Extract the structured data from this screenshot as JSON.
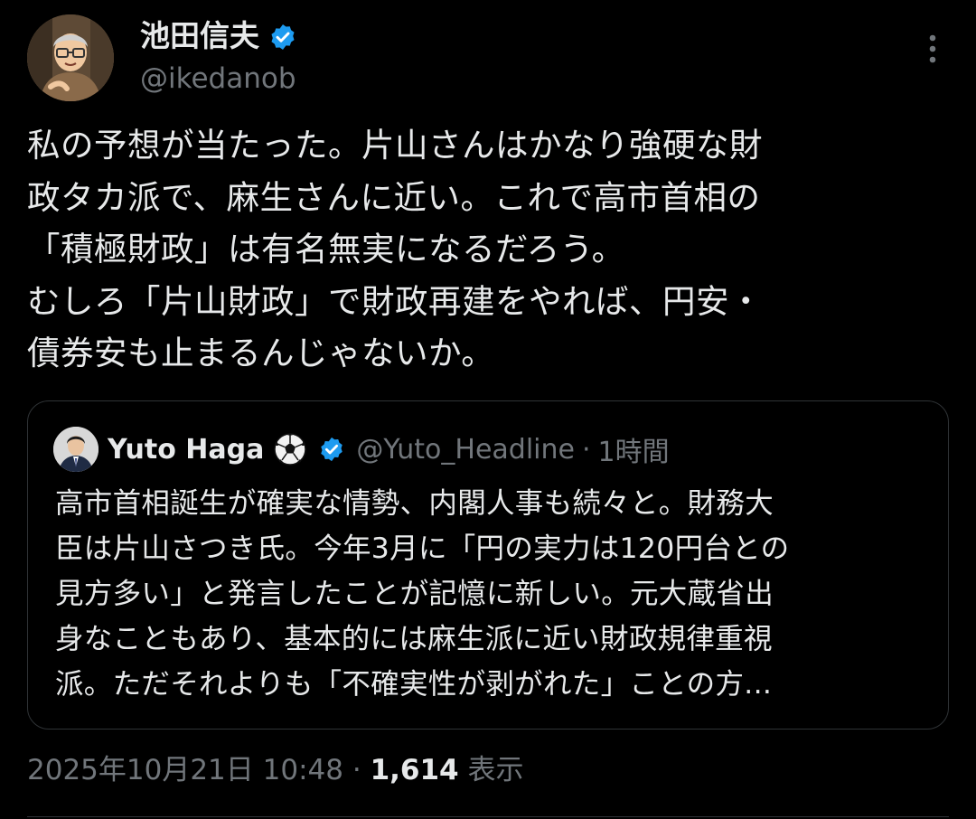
{
  "author": {
    "name": "池田信夫",
    "handle": "@ikedanob",
    "verified": true
  },
  "tweet": {
    "text": "私の予想が当たった。片山さんはかなり強硬な財\n政タカ派で、麻生さんに近い。これで高市首相の\n「積極財政」は有名無実になるだろう。\nむしろ「片山財政」で財政再建をやれば、円安・\n債券安も止まるんじゃないか。"
  },
  "quote": {
    "name": "Yuto Haga",
    "emoji_icon": "soccer-ball-icon",
    "verified": true,
    "handle": "@Yuto_Headline",
    "separator": "·",
    "time": "1時間",
    "text": "高市首相誕生が確実な情勢、内閣人事も続々と。財務大\n臣は片山さつき氏。今年3月に「円の実力は120円台との\n見方多い」と発言したことが記憶に新しい。元大蔵省出\n身なこともあり、基本的には麻生派に近い財政規律重視\n派。ただそれよりも「不確実性が剥がれた」ことの方..."
  },
  "meta": {
    "timestamp": "2025年10月21日 10:48",
    "separator": "·",
    "views_count": "1,614",
    "views_label": "表示"
  },
  "colors": {
    "background": "#000000",
    "text_primary": "#e7e9ea",
    "text_secondary": "#71767b",
    "verified_badge": "#1d9bf0",
    "border": "#2f3336"
  }
}
